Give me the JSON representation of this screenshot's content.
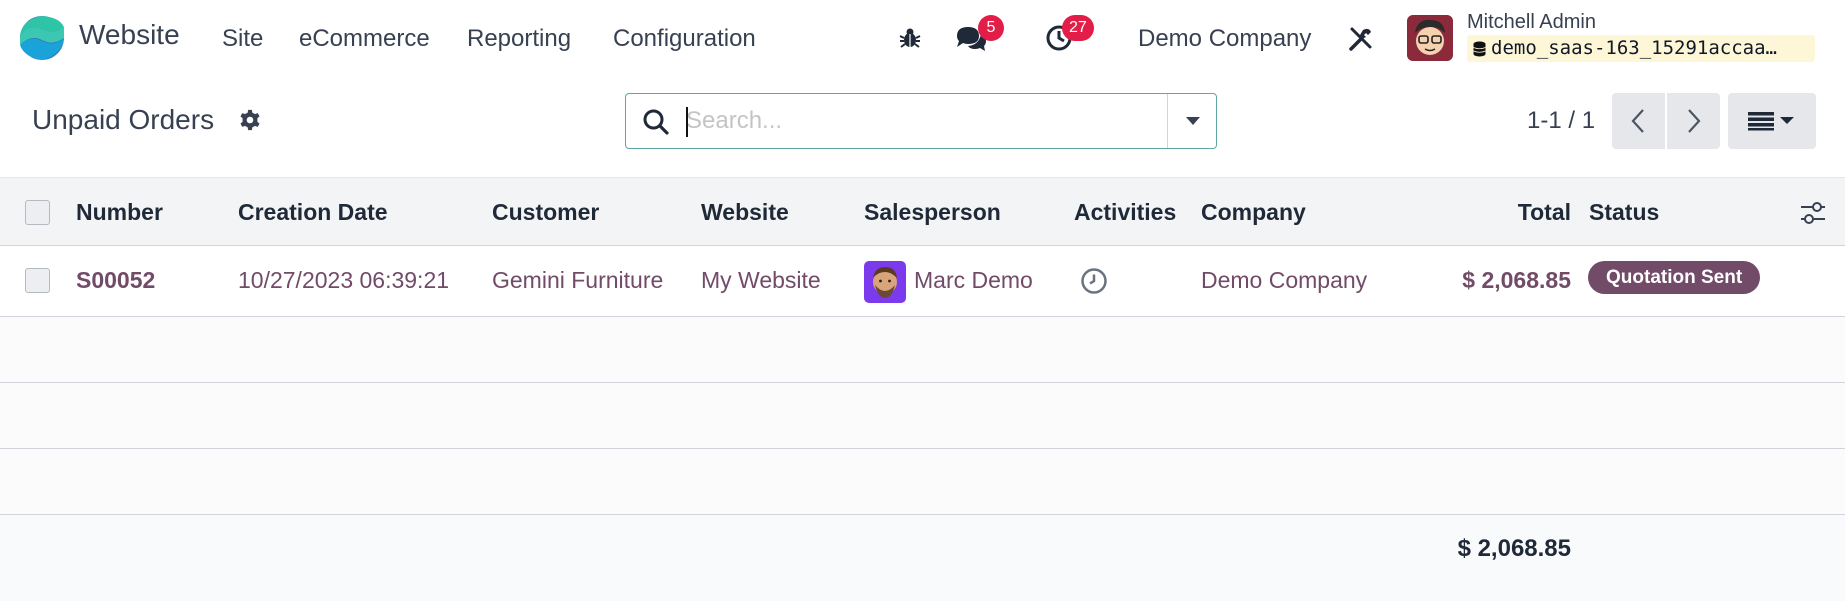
{
  "navbar": {
    "app_name": "Website",
    "menu": [
      "Site",
      "eCommerce",
      "Reporting",
      "Configuration"
    ],
    "messages_count": "5",
    "activities_count": "27",
    "company": "Demo Company",
    "user_name": "Mitchell Admin",
    "database": "demo_saas-163_15291accaa…"
  },
  "control_panel": {
    "title": "Unpaid Orders",
    "search_placeholder": "Search...",
    "pager": "1-1 / 1"
  },
  "table": {
    "columns": [
      "Number",
      "Creation Date",
      "Customer",
      "Website",
      "Salesperson",
      "Activities",
      "Company",
      "Total",
      "Status"
    ],
    "rows": [
      {
        "number": "S00052",
        "creation_date": "10/27/2023 06:39:21",
        "customer": "Gemini Furniture",
        "website": "My Website",
        "salesperson": "Marc Demo",
        "company": "Demo Company",
        "total": "$ 2,068.85",
        "status": "Quotation Sent"
      }
    ],
    "footer_total": "$ 2,068.85"
  },
  "colors": {
    "brand": "#714b67",
    "badge": "#e11d48",
    "search_border": "#5fa7a3"
  }
}
